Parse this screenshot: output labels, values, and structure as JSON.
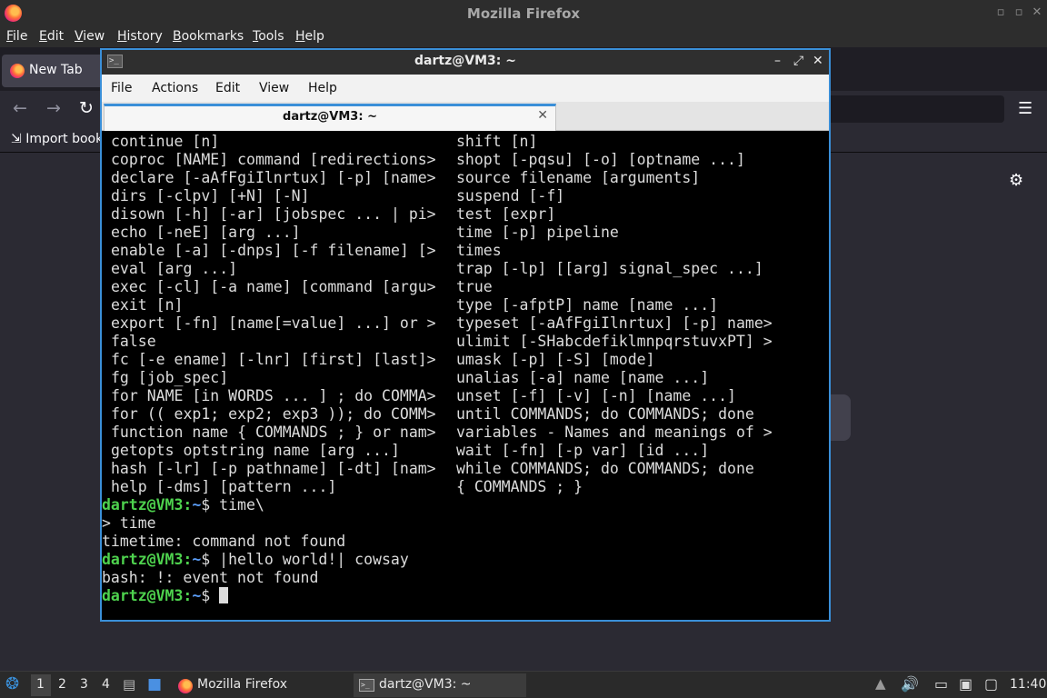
{
  "firefox": {
    "title": "Mozilla Firefox",
    "menu": {
      "file": "F",
      "file_rest": "ile",
      "edit": "E",
      "edit_rest": "dit",
      "view": "V",
      "view_rest": "iew",
      "history": "H",
      "history_rest": "istory",
      "bookmarks": "B",
      "bookmarks_rest": "ookmarks",
      "tools": "T",
      "tools_rest": "ools",
      "help": "H",
      "help_rest": "elp"
    },
    "tab_label": "New Tab",
    "bookmark_label": "Import book"
  },
  "terminal": {
    "title": "dartz@VM3: ~",
    "menu": [
      "File",
      "Actions",
      "Edit",
      "View",
      "Help"
    ],
    "tab_label": "dartz@VM3: ~",
    "left_col": [
      "continue [n]",
      "coproc [NAME] command [redirections>",
      "declare [-aAfFgiIlnrtux] [-p] [name>",
      "dirs [-clpv] [+N] [-N]",
      "disown [-h] [-ar] [jobspec ... | pi>",
      "echo [-neE] [arg ...]",
      "enable [-a] [-dnps] [-f filename] [>",
      "eval [arg ...]",
      "exec [-cl] [-a name] [command [argu>",
      "exit [n]",
      "export [-fn] [name[=value] ...] or >",
      "false",
      "fc [-e ename] [-lnr] [first] [last]>",
      "fg [job_spec]",
      "for NAME [in WORDS ... ] ; do COMMA>",
      "for (( exp1; exp2; exp3 )); do COMM>",
      "function name { COMMANDS ; } or nam>",
      "getopts optstring name [arg ...]",
      "hash [-lr] [-p pathname] [-dt] [nam>",
      "help [-dms] [pattern ...]"
    ],
    "right_col": [
      "shift [n]",
      "shopt [-pqsu] [-o] [optname ...]",
      "source filename [arguments]",
      "suspend [-f]",
      "test [expr]",
      "time [-p] pipeline",
      "times",
      "trap [-lp] [[arg] signal_spec ...]",
      "true",
      "type [-afptP] name [name ...]",
      "typeset [-aAfFgiIlnrtux] [-p] name>",
      "ulimit [-SHabcdefiklmnpqrstuvxPT] >",
      "umask [-p] [-S] [mode]",
      "unalias [-a] name [name ...]",
      "unset [-f] [-v] [-n] [name ...]",
      "until COMMANDS; do COMMANDS; done",
      "variables - Names and meanings of >",
      "wait [-fn] [-p var] [id ...]",
      "while COMMANDS; do COMMANDS; done",
      "{ COMMANDS ; }"
    ],
    "prompt_user": "dartz@VM3",
    "prompt_sep": ":",
    "prompt_path": "~",
    "prompt_end": "$ ",
    "session": [
      {
        "prompt": true,
        "text": "time\\"
      },
      {
        "prompt": false,
        "text": "> time"
      },
      {
        "prompt": false,
        "text": "timetime: command not found"
      },
      {
        "prompt": true,
        "text": "|hello world!| cowsay"
      },
      {
        "prompt": false,
        "text": "bash: !: event not found"
      },
      {
        "prompt": true,
        "text": "",
        "cursor": true
      }
    ]
  },
  "taskbar": {
    "workspaces": [
      "1",
      "2",
      "3",
      "4"
    ],
    "firefox_label": "Mozilla Firefox",
    "terminal_label": "dartz@VM3: ~",
    "clock": "11:40"
  }
}
